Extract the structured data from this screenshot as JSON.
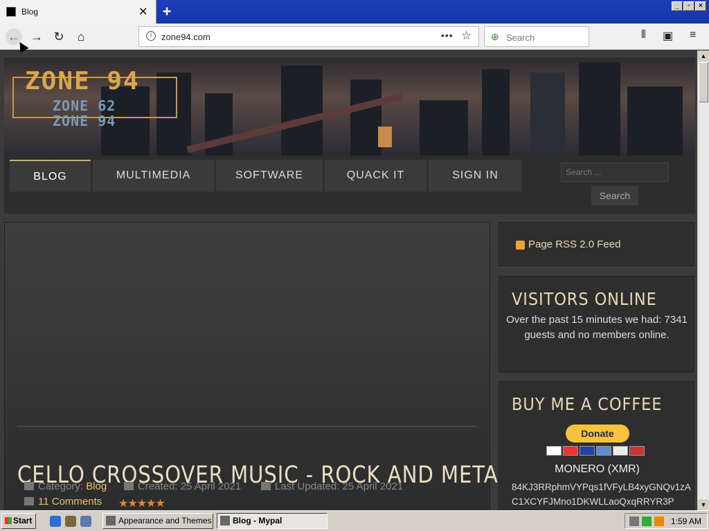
{
  "browser": {
    "tab_title": "Blog",
    "new_tab_symbol": "+",
    "url": "zone94.com",
    "search_placeholder": "Search",
    "window_buttons": [
      "_",
      "▫",
      "×"
    ]
  },
  "site": {
    "logo_main": "ZONE 94",
    "logo_sub1": "ZONE 62",
    "logo_sub2": "ZONE 94",
    "nav": [
      "BLOG",
      "MULTIMEDIA",
      "SOFTWARE",
      "QUACK IT",
      "SIGN IN"
    ],
    "active_nav": "BLOG",
    "search_placeholder": "Search ...",
    "search_button": "Search"
  },
  "post": {
    "title": "CELLO CROSSOVER MUSIC - ROCK AND METAL",
    "category_label": "Category:",
    "category": "Blog",
    "created": "Created: 25 April 2021",
    "updated": "Last Updated: 25 April 2021",
    "comments": "11 Comments",
    "rating_stars": 5
  },
  "sidebar": {
    "rss": "Page RSS 2.0 Feed",
    "visitors_title": "VISITORS ONLINE",
    "visitors_text": "Over the past 15 minutes we had: 7341 guests and no members online.",
    "coffee_title": "BUY ME A COFFEE",
    "donate": "Donate",
    "monero": "MONERO (XMR)",
    "address": "84KJ3RRphmVYPqs1fVFyLB4xyGNQv1zAC1XCYFJMno1DKWLLaoQxqRRYR3P"
  },
  "taskbar": {
    "start": "Start",
    "tasks": [
      "Appearance and Themes",
      "Blog - Mypal"
    ],
    "clock": "1:59 AM"
  },
  "colors": {
    "accent_gold": "#e8c36c",
    "title_cream": "#e9dfc4",
    "star_orange": "#e8872a",
    "donate_yellow": "#f7c33d"
  }
}
